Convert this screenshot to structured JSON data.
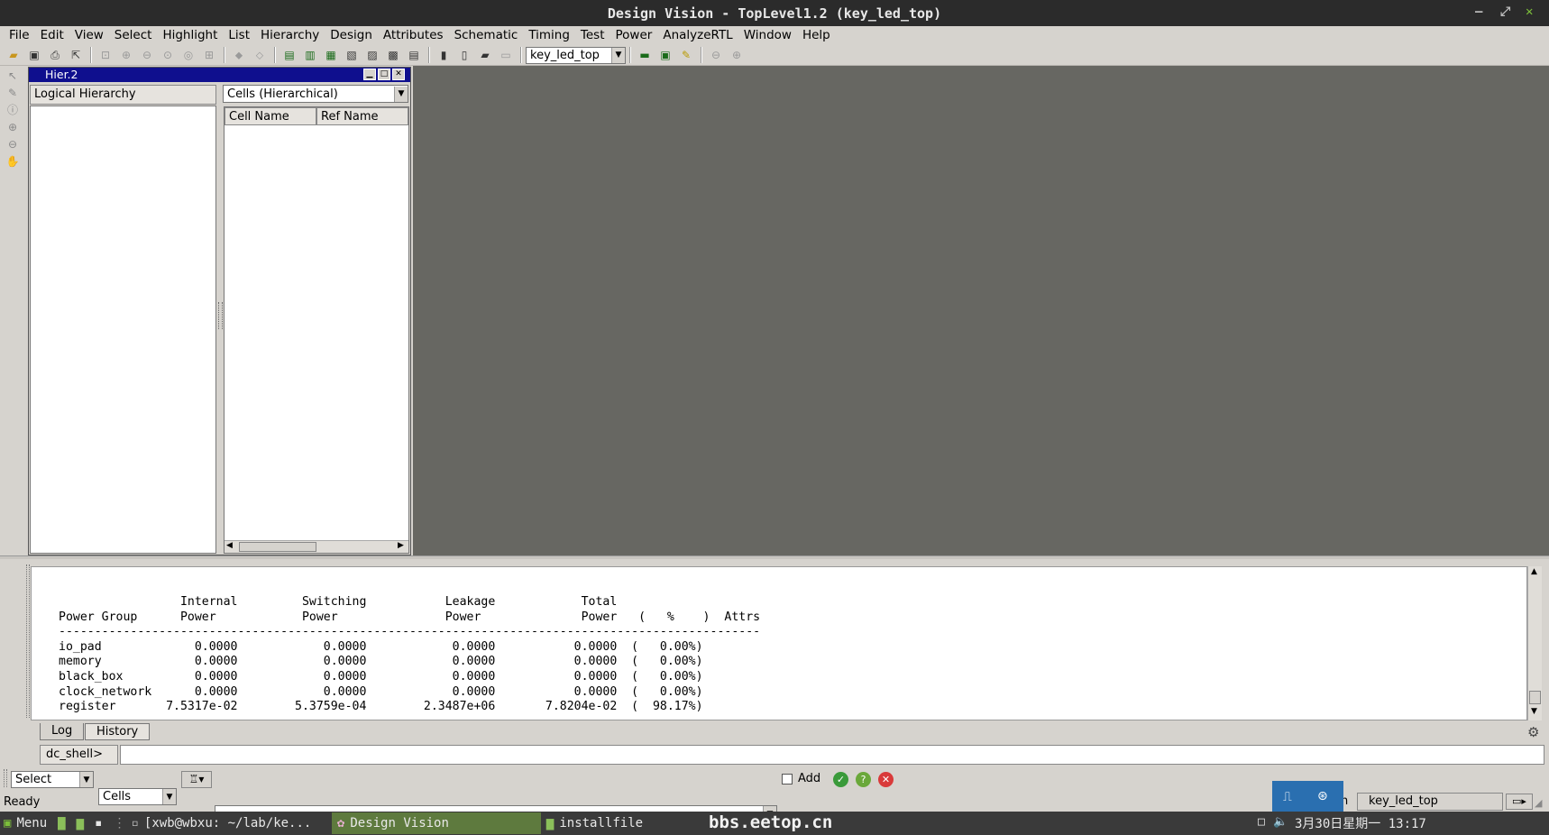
{
  "window": {
    "title": "Design Vision - TopLevel1.2 (key_led_top)"
  },
  "menu": [
    "File",
    "Edit",
    "View",
    "Select",
    "Highlight",
    "List",
    "Hierarchy",
    "Design",
    "Attributes",
    "Schematic",
    "Timing",
    "Test",
    "Power",
    "AnalyzeRTL",
    "Window",
    "Help"
  ],
  "toolbar": {
    "design_select_value": "key_led_top"
  },
  "hier": {
    "title": "Hier.2",
    "left_header": "Logical Hierarchy",
    "cells_select_value": "Cells (Hierarchical)",
    "columns": [
      "Cell Name",
      "Ref Name"
    ]
  },
  "log": {
    "header1": "                 Internal         Switching           Leakage            Total",
    "header2": "Power Group      Power            Power               Power              Power   (   %    )  Attrs",
    "divider": "--------------------------------------------------------------------------------------------------",
    "rows": [
      "io_pad             0.0000            0.0000            0.0000           0.0000  (   0.00%)",
      "memory             0.0000            0.0000            0.0000           0.0000  (   0.00%)",
      "black_box          0.0000            0.0000            0.0000           0.0000  (   0.00%)",
      "clock_network      0.0000            0.0000            0.0000           0.0000  (   0.00%)",
      "register       7.5317e-02        5.3759e-04        2.3487e+06       7.8204e-02  (  98.17%)"
    ]
  },
  "tabs": {
    "log": "Log",
    "history": "History"
  },
  "shell": {
    "prompt": "dc_shell>"
  },
  "select_bar": {
    "mode": "Select",
    "type": "Cells",
    "add_label": "Add"
  },
  "status": {
    "text": "Ready",
    "design": "key_led_top",
    "partial": "n"
  },
  "taskbar": {
    "menu": "Menu",
    "term": "[xwb@wbxu: ~/lab/ke...",
    "dv": "Design Vision",
    "files": "installfile",
    "watermark": "bbs.eetop.cn",
    "clock": "3月30日星期一  13:17"
  },
  "colors": {
    "titlebar": "#2b2b2b",
    "hier_title": "#0f0f8e",
    "workspace": "#676762",
    "taskbar": "#3a3a3a",
    "dv_task": "#5e7a3e"
  }
}
